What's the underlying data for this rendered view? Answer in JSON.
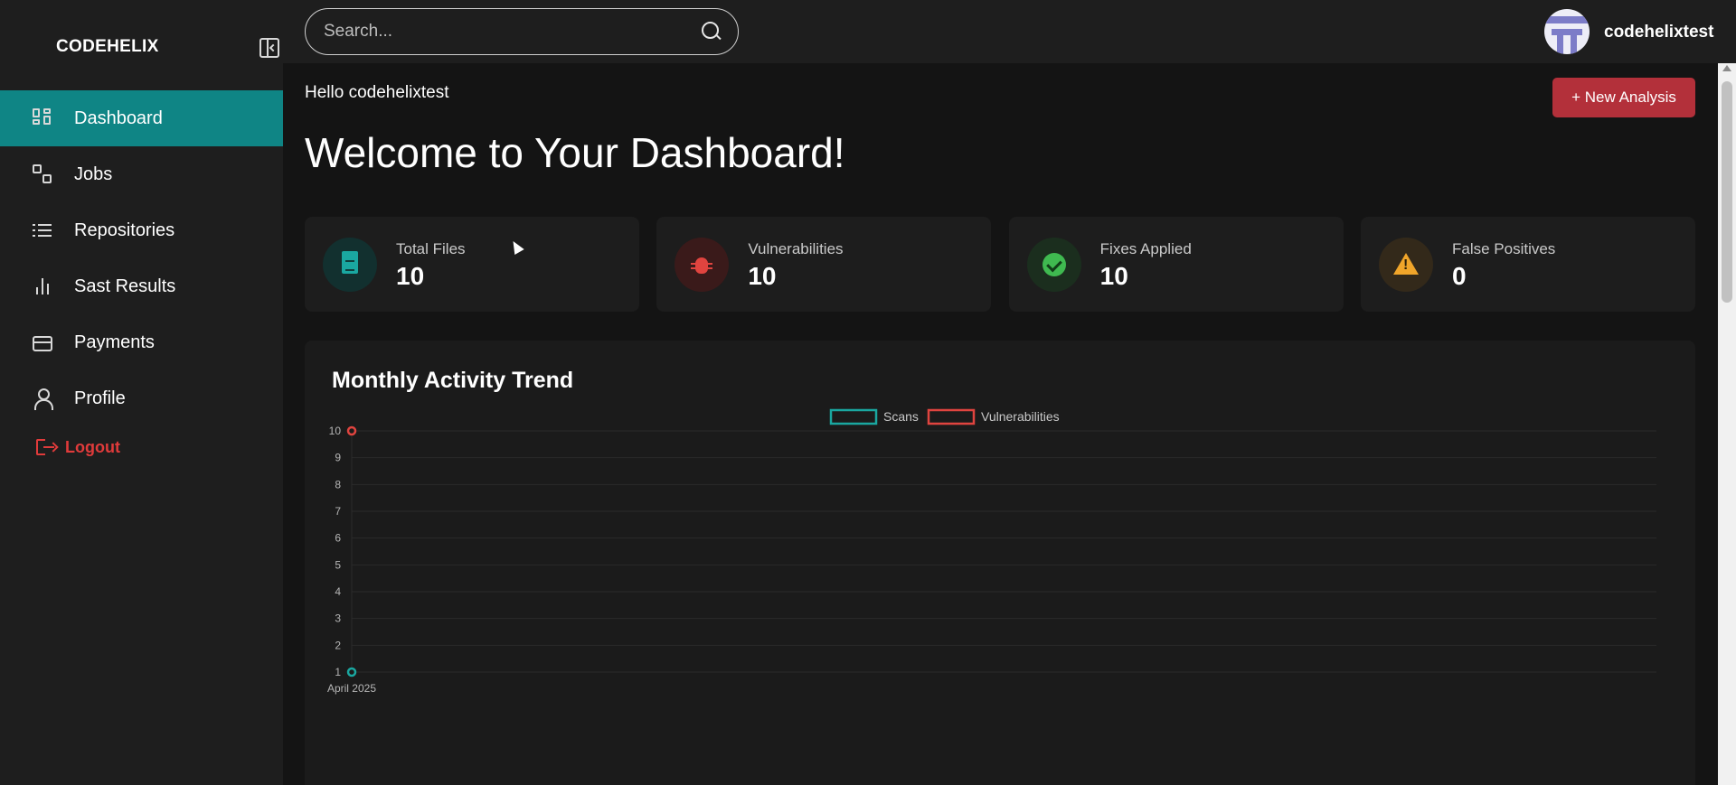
{
  "app": {
    "brand": "CODEHELIX",
    "accent_color": "#0f8585"
  },
  "sidebar": {
    "items": [
      {
        "label": "Dashboard",
        "icon": "dashboard-grid-icon",
        "active": true
      },
      {
        "label": "Jobs",
        "icon": "jobs-icon",
        "active": false
      },
      {
        "label": "Repositories",
        "icon": "list-icon",
        "active": false
      },
      {
        "label": "Sast Results",
        "icon": "bar-chart-icon",
        "active": false
      },
      {
        "label": "Payments",
        "icon": "credit-card-icon",
        "active": false
      },
      {
        "label": "Profile",
        "icon": "user-icon",
        "active": false
      }
    ],
    "logout_label": "Logout"
  },
  "topbar": {
    "search_placeholder": "Search...",
    "username": "codehelixtest"
  },
  "main": {
    "greeting": "Hello codehelixtest",
    "title": "Welcome to Your Dashboard!",
    "new_analysis_label": "+ New Analysis",
    "stats": [
      {
        "label": "Total Files",
        "value": "10",
        "icon": "document-icon",
        "color": "#1aa7a0"
      },
      {
        "label": "Vulnerabilities",
        "value": "10",
        "icon": "bug-icon",
        "color": "#e0443f"
      },
      {
        "label": "Fixes Applied",
        "value": "10",
        "icon": "check-circle-icon",
        "color": "#3fb950"
      },
      {
        "label": "False Positives",
        "value": "0",
        "icon": "warning-icon",
        "color": "#f0a52a"
      }
    ]
  },
  "chart_data": {
    "type": "line",
    "title": "Monthly Activity Trend",
    "categories": [
      "April 2025"
    ],
    "series": [
      {
        "name": "Scans",
        "values": [
          1
        ],
        "color": "#1aa7a0"
      },
      {
        "name": "Vulnerabilities",
        "values": [
          10
        ],
        "color": "#e0443f"
      }
    ],
    "ylim": [
      1,
      10
    ],
    "yticks": [
      "1",
      "2",
      "3",
      "4",
      "5",
      "6",
      "7",
      "8",
      "9",
      "10"
    ],
    "grid": true,
    "legend_position": "top-center"
  }
}
